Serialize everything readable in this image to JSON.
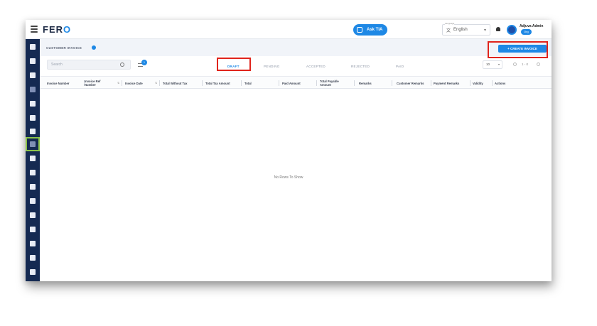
{
  "header": {
    "brand_main": "FER",
    "brand_accent": "O",
    "ask_label": "Ask TIA",
    "language_caption": "Language",
    "language_value": "English",
    "user_name": "Adjuva Admin",
    "user_badge": "Org"
  },
  "page": {
    "title": "CUSTOMER INVOICE",
    "create_button": "+ CREATE INVOICE"
  },
  "toolbar": {
    "search_placeholder": "Search",
    "filter_count": "1"
  },
  "tabs": [
    {
      "label": "DRAFT",
      "active": true
    },
    {
      "label": "PENDING",
      "active": false
    },
    {
      "label": "ACCEPTED",
      "active": false
    },
    {
      "label": "REJECTED",
      "active": false
    },
    {
      "label": "PAID",
      "active": false
    }
  ],
  "pagination": {
    "per_page": "10",
    "range_text": "1 - 0"
  },
  "table": {
    "columns": [
      "Invoice Number",
      "Invoice Ref Number",
      "Invoice Date",
      "Total Without Tax",
      "Total Tax Amount",
      "Total",
      "Paid Amount",
      "Total Payable Amount",
      "Remarks",
      "Customer Remarks",
      "Payment Remarks",
      "Validity",
      "Actions"
    ],
    "empty_message": "No Rows To Show"
  },
  "colors": {
    "sidebar": "#152a52",
    "accent": "#1e88e5",
    "highlight_red": "#e0241c",
    "highlight_green": "#8bc34a"
  },
  "icons": {
    "sidebar": [
      "dashboard-icon",
      "building-icon",
      "book-icon",
      "chart-icon",
      "truck-icon",
      "car-icon",
      "calendar-icon",
      "invoice-icon",
      "document-icon",
      "bus-icon",
      "tag-icon",
      "office-icon",
      "grid-icon",
      "copy-icon",
      "settings-icon",
      "database-icon",
      "report-icon"
    ]
  }
}
